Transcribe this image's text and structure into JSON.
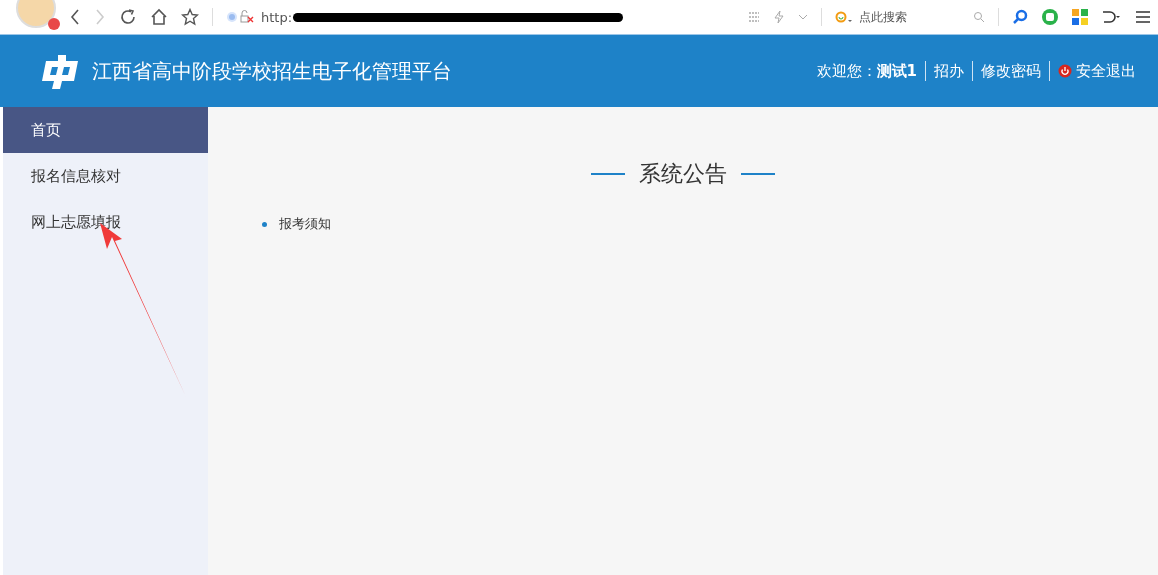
{
  "browser": {
    "url": "http:",
    "search_placeholder": "点此搜索"
  },
  "header": {
    "title": "江西省高中阶段学校招生电子化管理平台",
    "welcome_label": "欢迎您：",
    "user": "测试1",
    "links": [
      {
        "label": "招办",
        "kind": "link"
      },
      {
        "label": "修改密码",
        "kind": "link"
      },
      {
        "label": "安全退出",
        "kind": "logout"
      }
    ]
  },
  "sidebar": {
    "items": [
      {
        "label": "首页",
        "selected": true
      },
      {
        "label": "报名信息核对",
        "selected": false
      },
      {
        "label": "网上志愿填报",
        "selected": false
      }
    ]
  },
  "notice": {
    "title": "系统公告",
    "items": [
      "报考须知"
    ]
  }
}
